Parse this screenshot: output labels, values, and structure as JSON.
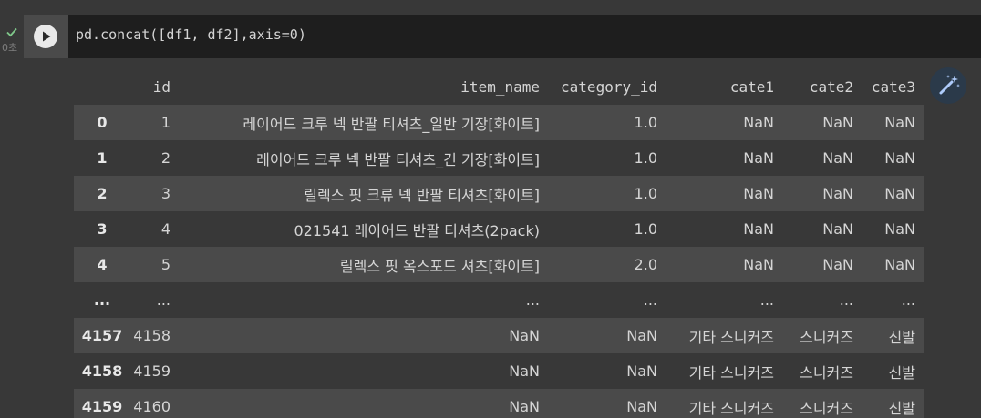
{
  "cell": {
    "status_icon": "check-icon",
    "exec_time": "0초",
    "code": "pd.concat([df1, df2],axis=0)"
  },
  "colors": {
    "background": "#383838",
    "code_bg": "#1e1e1e",
    "row_stripe": "#4a4a4a",
    "check": "#7fc78a"
  },
  "table": {
    "columns": [
      "",
      "id",
      "item_name",
      "category_id",
      "cate1",
      "cate2",
      "cate3"
    ],
    "rows": [
      {
        "index": "0",
        "cells": [
          "1",
          "레이어드 크루 넥 반팔 티셔츠_일반 기장[화이트]",
          "1.0",
          "NaN",
          "NaN",
          "NaN"
        ]
      },
      {
        "index": "1",
        "cells": [
          "2",
          "레이어드 크루 넥 반팔 티셔츠_긴 기장[화이트]",
          "1.0",
          "NaN",
          "NaN",
          "NaN"
        ]
      },
      {
        "index": "2",
        "cells": [
          "3",
          "릴렉스 핏 크류 넥 반팔 티셔츠[화이트]",
          "1.0",
          "NaN",
          "NaN",
          "NaN"
        ]
      },
      {
        "index": "3",
        "cells": [
          "4",
          "021541 레이어드 반팔 티셔츠(2pack)",
          "1.0",
          "NaN",
          "NaN",
          "NaN"
        ]
      },
      {
        "index": "4",
        "cells": [
          "5",
          "릴렉스 핏 옥스포드 셔츠[화이트]",
          "2.0",
          "NaN",
          "NaN",
          "NaN"
        ]
      },
      {
        "index": "...",
        "cells": [
          "...",
          "...",
          "...",
          "...",
          "...",
          "..."
        ]
      },
      {
        "index": "4157",
        "cells": [
          "4158",
          "NaN",
          "NaN",
          "기타 스니커즈",
          "스니커즈",
          "신발"
        ]
      },
      {
        "index": "4158",
        "cells": [
          "4159",
          "NaN",
          "NaN",
          "기타 스니커즈",
          "스니커즈",
          "신발"
        ]
      },
      {
        "index": "4159",
        "cells": [
          "4160",
          "NaN",
          "NaN",
          "기타 스니커즈",
          "스니커즈",
          "신발"
        ]
      }
    ]
  },
  "toolbar": {
    "magic_icon": "magic-wand-icon",
    "run_icon": "play-icon"
  }
}
